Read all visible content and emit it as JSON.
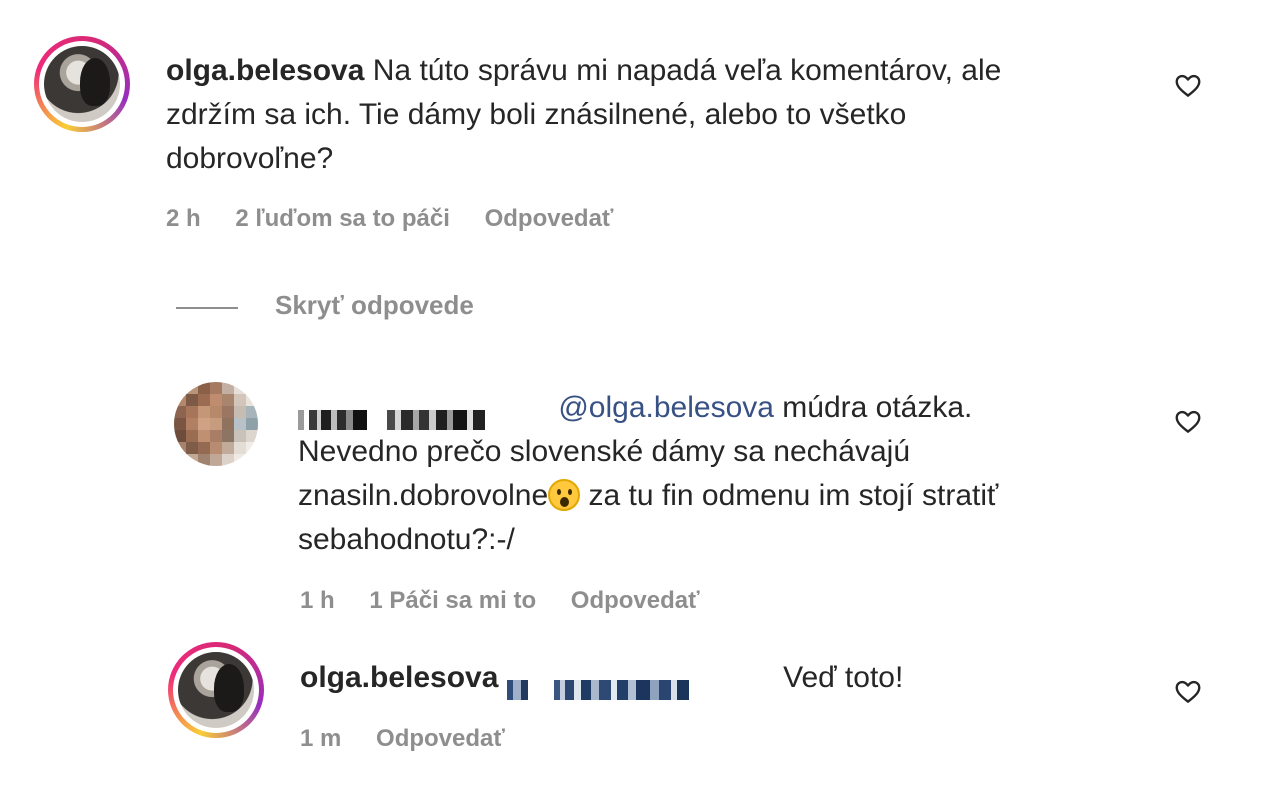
{
  "comments": [
    {
      "username": "olga.belesova",
      "text": "Na túto správu mi napadá veľa komentárov, ale zdržím sa ich. Tie dámy boli znásilnené, alebo to všetko dobrovoľne?",
      "line1": "Na túto správu mi napadá veľa komentárov, ale",
      "line2": "zdržím sa ich. Tie dámy boli znásilnené, alebo to všetko",
      "line3": "dobrovoľne?",
      "time": "2 h",
      "likes": "2 ľuďom sa to páči",
      "reply": "Odpovedať"
    },
    {
      "mention": "@olga.belesova",
      "line1_rest": " múdra otázka.",
      "line2": "Nevedno prečo slovenské dámy sa nechávajú",
      "line3_a": "znasiln.dobrovolne",
      "line3_b": " za tu fin odmenu im stojí stratiť",
      "line4": "sebahodnotu?:-/",
      "time": "1 h",
      "likes": "1 Páči sa mi to",
      "reply": "Odpovedať"
    },
    {
      "username": "olga.belesova",
      "text_rest": "Veď toto!",
      "time": "1 m",
      "reply": "Odpovedať"
    }
  ],
  "toggle": {
    "label": "Skryť odpovede"
  },
  "icons": {
    "like": "heart-icon",
    "emoji": "astonished-face-emoji"
  },
  "colors": {
    "mention": "#385185",
    "meta": "#8e8e8e",
    "text": "#262626"
  }
}
